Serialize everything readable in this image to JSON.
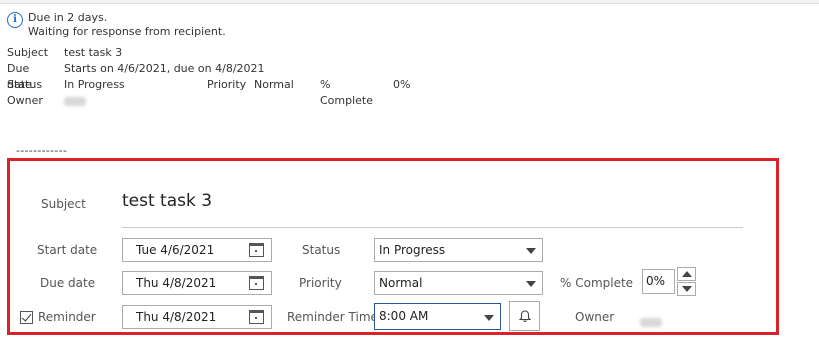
{
  "info": {
    "line1": "Due in 2 days.",
    "line2": "Waiting for response from recipient."
  },
  "summary": {
    "subject_label": "Subject",
    "subject_value": "test task 3",
    "due_label": "Due date",
    "due_value": "Starts on 4/6/2021, due on 4/8/2021",
    "status_label": "Status",
    "status_value": "In Progress",
    "priority_label": "Priority",
    "priority_value": "Normal",
    "complete_label": "% Complete",
    "complete_value": "0%",
    "owner_label": "Owner"
  },
  "separator": "------------",
  "form": {
    "subject_label": "Subject",
    "subject_value": "test task 3",
    "start_label": "Start date",
    "start_value": "Tue 4/6/2021",
    "due_label": "Due date",
    "due_value": "Thu 4/8/2021",
    "reminder_label": "Reminder",
    "reminder_checked": true,
    "reminder_value": "Thu 4/8/2021",
    "status_label": "Status",
    "status_value": "In Progress",
    "priority_label": "Priority",
    "priority_value": "Normal",
    "reminder_time_label": "Reminder Time",
    "reminder_time_value": "8:00 AM",
    "complete_label": "% Complete",
    "complete_value": "0%",
    "owner_label": "Owner"
  },
  "colors": {
    "frame": "#d9222a",
    "info_icon": "#1f6cc2"
  }
}
